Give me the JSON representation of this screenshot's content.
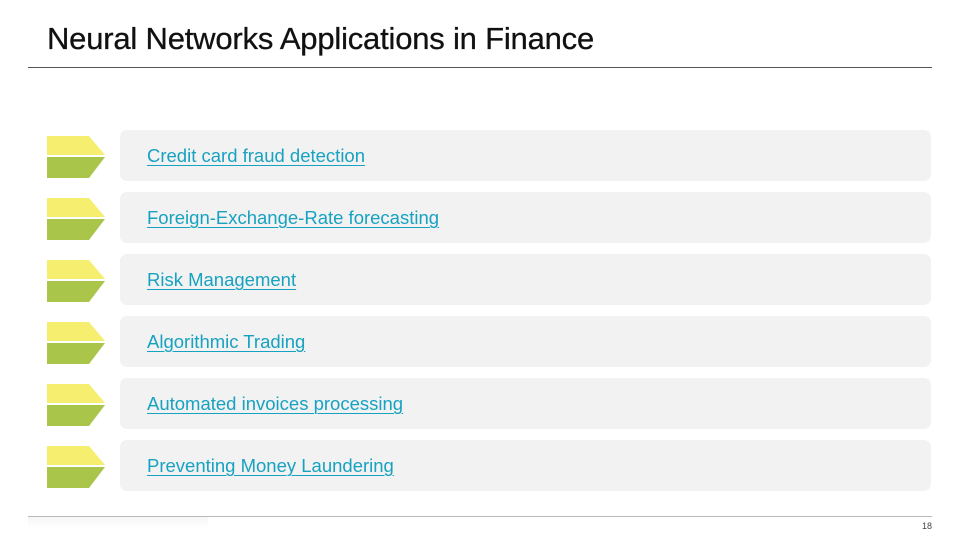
{
  "slide": {
    "title": "Neural Networks Applications in Finance",
    "page_number": "18"
  },
  "colors": {
    "chevron_top": "#f5ee6f",
    "chevron_bottom": "#a9c54a",
    "link": "#17a2c1",
    "item_background": "#f2f2f2"
  },
  "items": [
    {
      "label": "Credit card fraud detection",
      "icon": "chevron-arrow-icon"
    },
    {
      "label": "Foreign-Exchange-Rate forecasting",
      "icon": "chevron-arrow-icon"
    },
    {
      "label": "Risk Management",
      "icon": "chevron-arrow-icon"
    },
    {
      "label": "Algorithmic Trading",
      "icon": "chevron-arrow-icon"
    },
    {
      "label": "Automated invoices processing",
      "icon": "chevron-arrow-icon"
    },
    {
      "label": "Preventing Money Laundering",
      "icon": "chevron-arrow-icon"
    }
  ]
}
